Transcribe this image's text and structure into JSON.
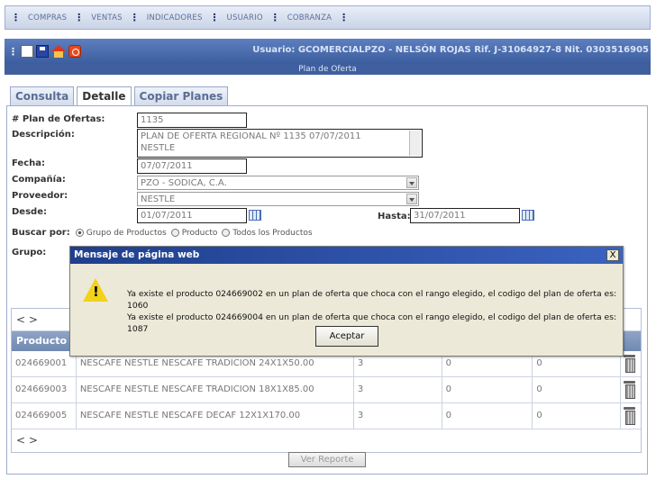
{
  "menu": {
    "items": [
      "COMPRAS",
      "VENTAS",
      "INDICADORES",
      "USUARIO",
      "COBRANZA"
    ]
  },
  "toolbar": {
    "user_info": "Usuario: GCOMERCIALPZO - NELSÓN ROJAS   Rif. J-31064927-8  Nit. 0303516905",
    "icons": [
      "new-document-icon",
      "save-icon",
      "home-icon",
      "power-icon"
    ]
  },
  "page_title": "Plan de Oferta",
  "tabs": [
    "Consulta",
    "Detalle",
    "Copiar Planes"
  ],
  "form": {
    "plan_label": "# Plan de Ofertas:",
    "plan_value": "1135",
    "descripcion_label": "Descripción:",
    "descripcion_line1": "PLAN DE OFERTA REGIONAL Nº 1135 07/07/2011",
    "descripcion_line2": "NESTLE",
    "fecha_label": "Fecha:",
    "fecha_value": "07/07/2011",
    "compania_label": "Compañía:",
    "compania_value": "PZO - SODICA, C.A.",
    "proveedor_label": "Proveedor:",
    "proveedor_value": "NESTLE",
    "desde_label": "Desde:",
    "desde_value": "01/07/2011",
    "hasta_label": "Hasta:",
    "hasta_value": "31/07/2011",
    "buscar_label": "Buscar por:",
    "opt_grupo": "Grupo de Productos",
    "opt_producto": "Producto",
    "opt_todos": "Todos los Productos",
    "grupo_label": "Grupo:"
  },
  "table": {
    "pager": "< >",
    "header": "Producto",
    "rows": [
      {
        "code": "024669001",
        "name": "NESCAFE NESTLE NESCAFE TRADICION 24X1X50.00",
        "a": "3",
        "b": "0",
        "c": "0"
      },
      {
        "code": "024669003",
        "name": "NESCAFE NESTLE NESCAFE TRADICION 18X1X85.00",
        "a": "3",
        "b": "0",
        "c": "0"
      },
      {
        "code": "024669005",
        "name": "NESCAFE NESTLE NESCAFE DECAF 12X1X170.00",
        "a": "3",
        "b": "0",
        "c": "0"
      }
    ]
  },
  "report_button": "Ver Reporte",
  "dialog": {
    "title": "Mensaje de página web",
    "close": "X",
    "line1": "Ya existe el producto 024669002 en un plan de oferta que choca con el rango elegido, el codigo del plan de oferta es: 1060",
    "line2": "Ya existe el producto 024669004 en un plan de oferta que choca con el rango elegido, el codigo del plan de oferta es: 1087",
    "button": "Aceptar"
  }
}
